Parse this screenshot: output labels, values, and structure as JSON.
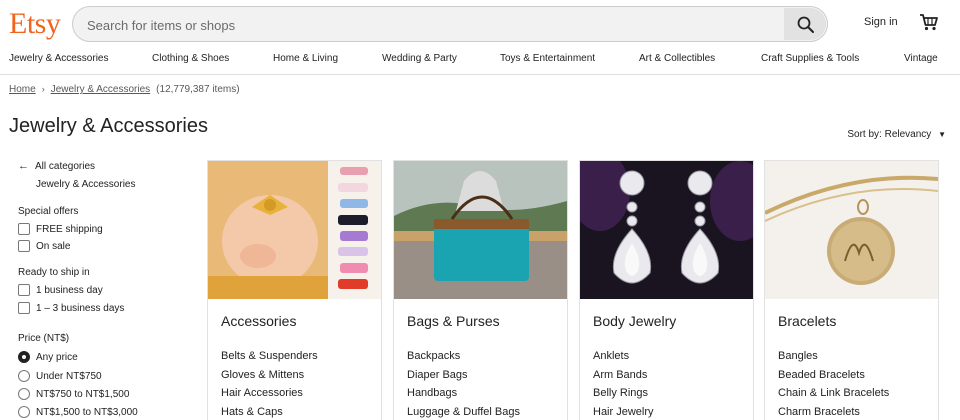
{
  "header": {
    "logo": "Etsy",
    "search_placeholder": "Search for items or shops",
    "signin": "Sign in"
  },
  "nav": [
    "Jewelry & Accessories",
    "Clothing & Shoes",
    "Home & Living",
    "Wedding & Party",
    "Toys & Entertainment",
    "Art & Collectibles",
    "Craft Supplies & Tools",
    "Vintage"
  ],
  "breadcrumb": {
    "home": "Home",
    "current": "Jewelry & Accessories",
    "count": "(12,779,387 items)"
  },
  "page_title": "Jewelry & Accessories",
  "sort": "Sort by: Relevancy",
  "sidebar": {
    "all_categories": "All categories",
    "current_category": "Jewelry & Accessories",
    "special_offers": {
      "heading": "Special offers",
      "options": [
        "FREE shipping",
        "On sale"
      ]
    },
    "ready_to_ship": {
      "heading": "Ready to ship in",
      "options": [
        "1 business day",
        "1 – 3 business days"
      ]
    },
    "price": {
      "heading": "Price (NT$)",
      "options": [
        "Any price",
        "Under NT$750",
        "NT$750 to NT$1,500",
        "NT$1,500 to NT$3,000"
      ],
      "selected": 0
    }
  },
  "categories": [
    {
      "title": "Accessories",
      "links": [
        "Belts & Suspenders",
        "Gloves & Mittens",
        "Hair Accessories",
        "Hats & Caps"
      ]
    },
    {
      "title": "Bags & Purses",
      "links": [
        "Backpacks",
        "Diaper Bags",
        "Handbags",
        "Luggage & Duffel Bags"
      ]
    },
    {
      "title": "Body Jewelry",
      "links": [
        "Anklets",
        "Arm Bands",
        "Belly Rings",
        "Hair Jewelry"
      ]
    },
    {
      "title": "Bracelets",
      "links": [
        "Bangles",
        "Beaded Bracelets",
        "Chain & Link Bracelets",
        "Charm Bracelets"
      ]
    }
  ]
}
